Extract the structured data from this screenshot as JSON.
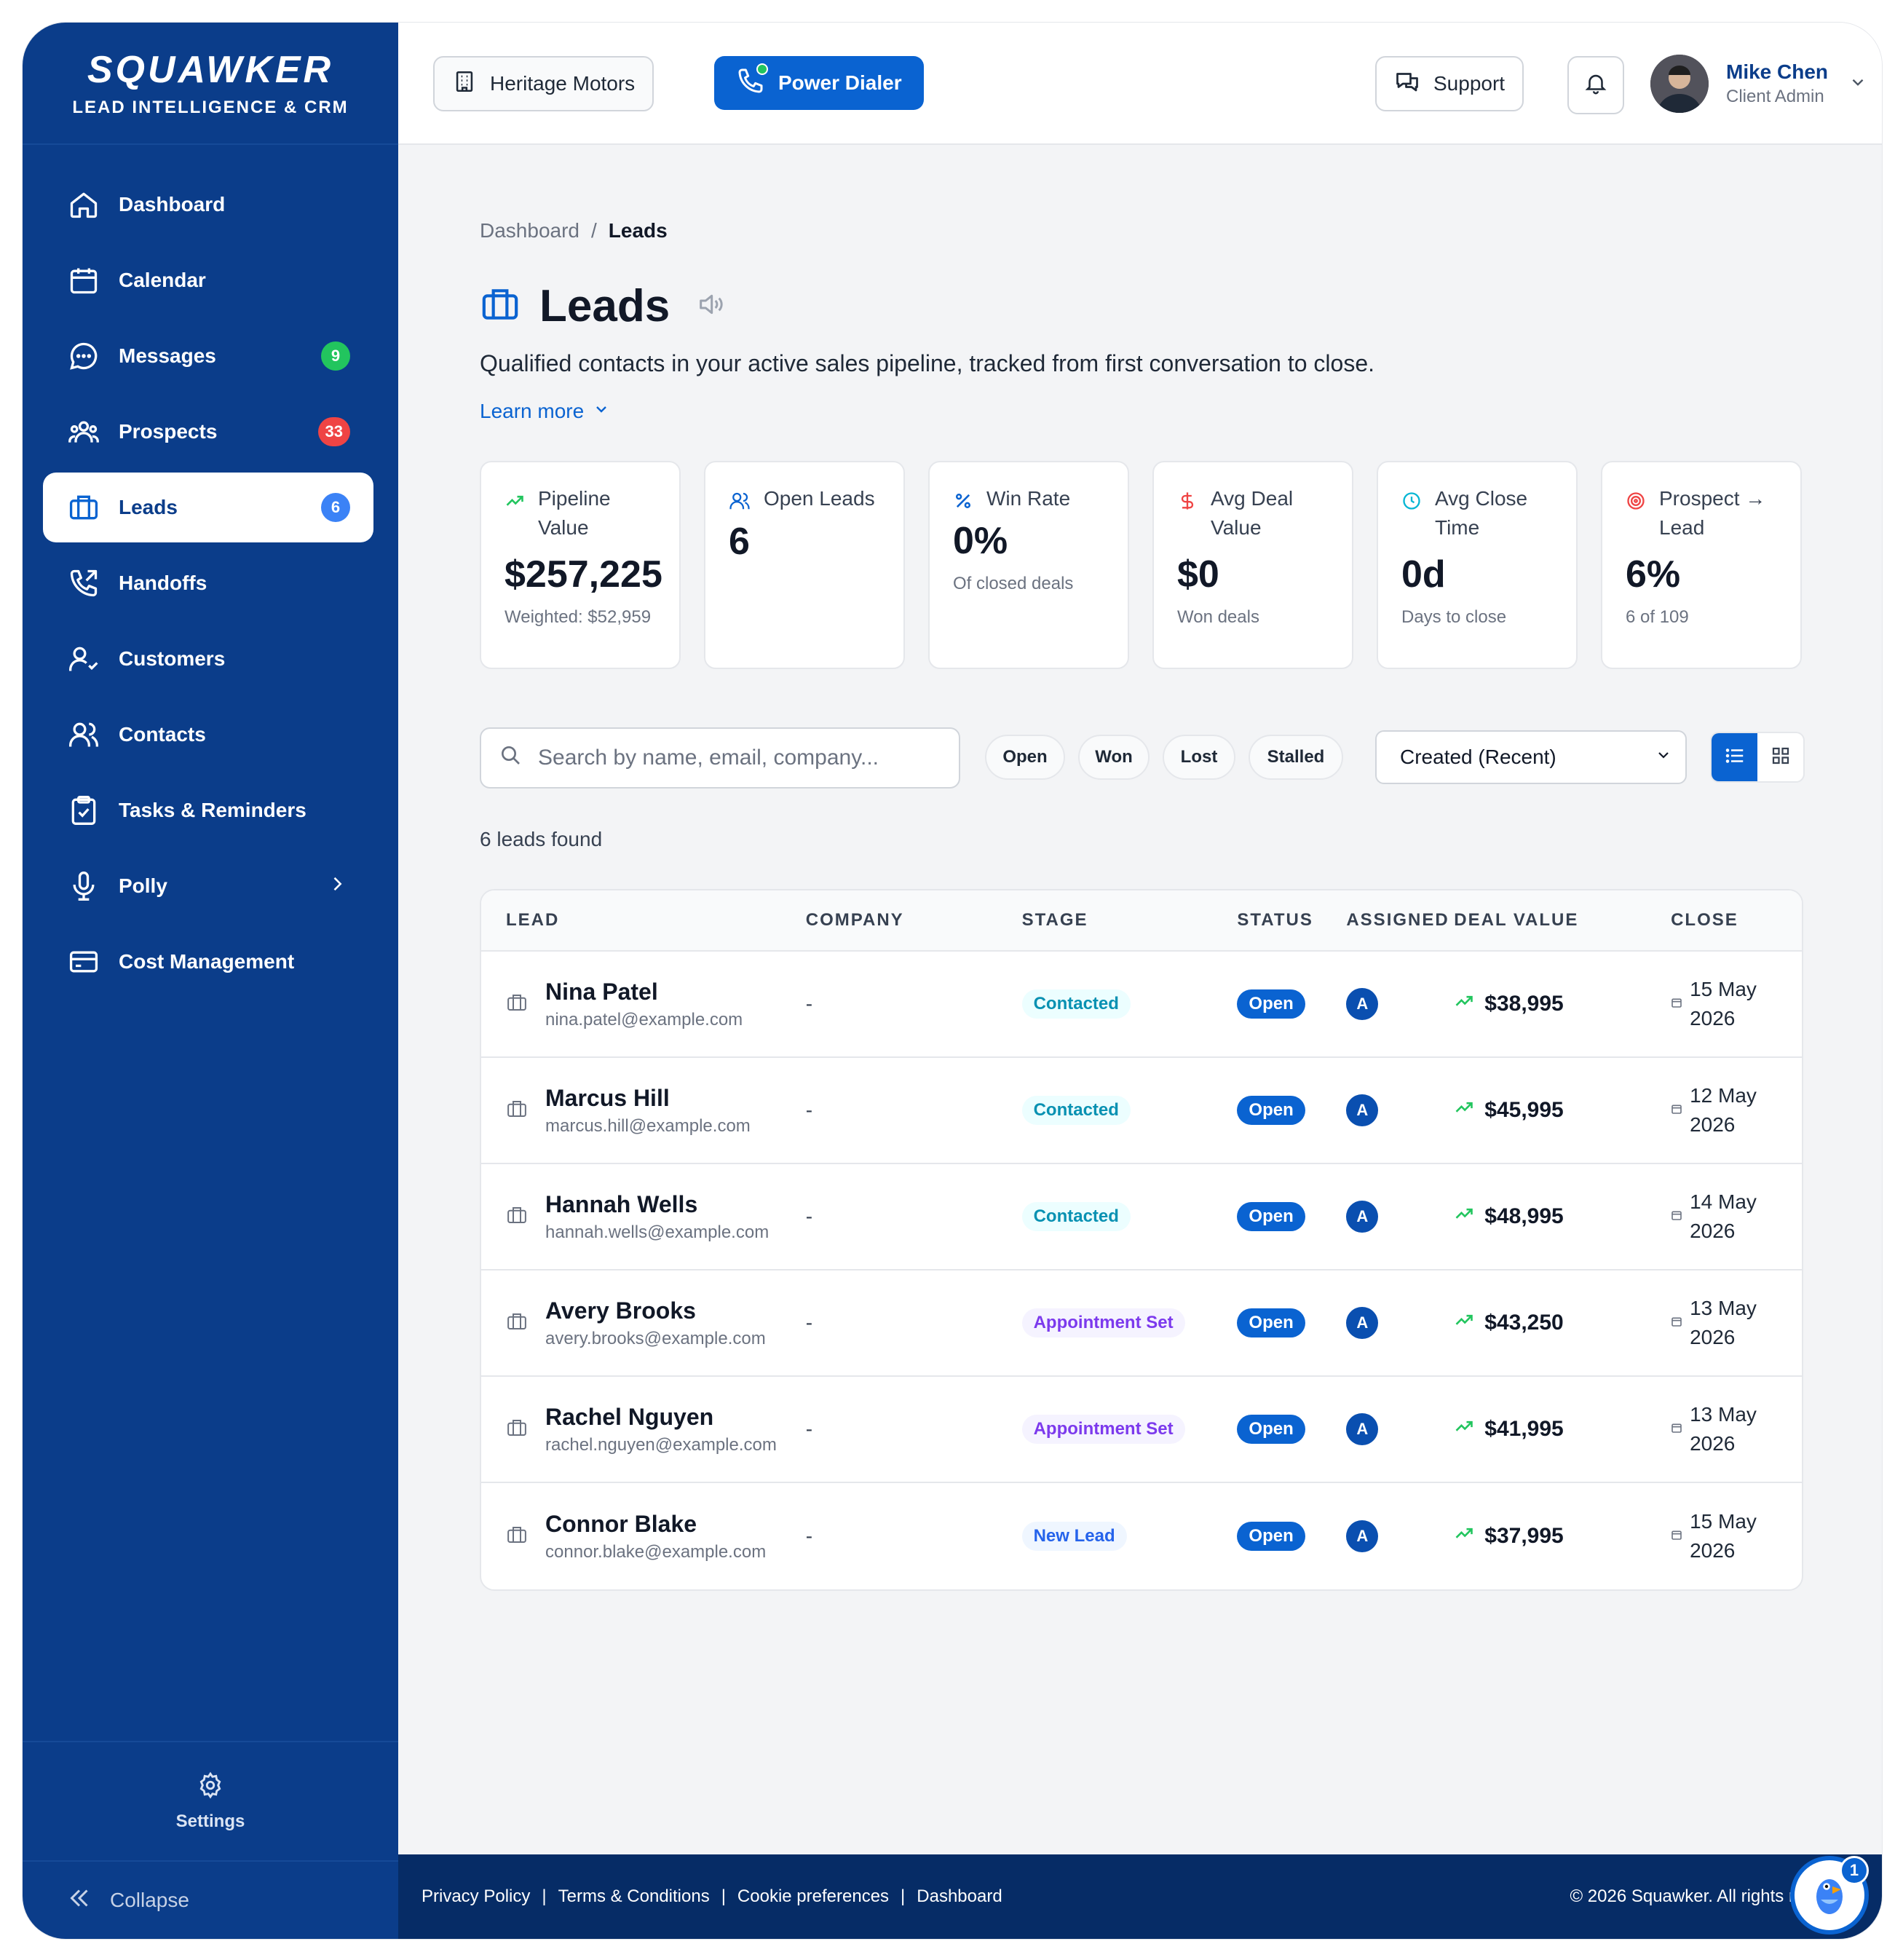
{
  "brand": {
    "name": "SQUAWKER",
    "tagline": "LEAD INTELLIGENCE & CRM"
  },
  "sidebar": {
    "items": [
      {
        "label": "Dashboard",
        "icon": "home-icon"
      },
      {
        "label": "Calendar",
        "icon": "calendar-icon"
      },
      {
        "label": "Messages",
        "icon": "chat-icon",
        "badge": "9",
        "badge_color": "#22c55e"
      },
      {
        "label": "Prospects",
        "icon": "people-icon",
        "badge": "33",
        "badge_color": "#ef4444"
      },
      {
        "label": "Leads",
        "icon": "briefcase-icon",
        "badge": "6",
        "badge_color": "#3b82f6",
        "active": true
      },
      {
        "label": "Handoffs",
        "icon": "phone-forward-icon"
      },
      {
        "label": "Customers",
        "icon": "user-check-icon"
      },
      {
        "label": "Contacts",
        "icon": "users-icon"
      },
      {
        "label": "Tasks & Reminders",
        "icon": "clipboard-check-icon"
      },
      {
        "label": "Polly",
        "icon": "microphone-icon",
        "has_submenu": true
      },
      {
        "label": "Cost Management",
        "icon": "credit-card-icon"
      }
    ],
    "settings_label": "Settings",
    "collapse_label": "Collapse"
  },
  "header": {
    "dealership": "Heritage Motors",
    "power_dialer": "Power Dialer",
    "support": "Support",
    "user": {
      "name": "Mike Chen",
      "role": "Client Admin"
    }
  },
  "breadcrumb": {
    "root": "Dashboard",
    "separator": "/",
    "current": "Leads"
  },
  "page": {
    "title": "Leads",
    "subtitle": "Qualified contacts in your active sales pipeline, tracked from first conversation to close.",
    "learn_more": "Learn more"
  },
  "stats": [
    {
      "label": "Pipeline Value",
      "value": "$257,225",
      "sub": "Weighted: $52,959",
      "icon": "trend-up-icon",
      "icon_color": "#22c55e"
    },
    {
      "label": "Open Leads",
      "value": "6",
      "sub": "",
      "icon": "users-icon",
      "icon_color": "#0a63d1"
    },
    {
      "label": "Win Rate",
      "value": "0%",
      "sub": "Of closed deals",
      "icon": "percent-icon",
      "icon_color": "#0a63d1"
    },
    {
      "label": "Avg Deal Value",
      "value": "$0",
      "sub": "Won deals",
      "icon": "dollar-icon",
      "icon_color": "#ef4444"
    },
    {
      "label": "Avg Close Time",
      "value": "0d",
      "sub": "Days to close",
      "icon": "clock-icon",
      "icon_color": "#06b6d4"
    },
    {
      "label": "Prospect → Lead",
      "value": "6%",
      "sub": "6 of 109",
      "icon": "target-icon",
      "icon_color": "#ef4444"
    }
  ],
  "search": {
    "placeholder": "Search by name, email, company..."
  },
  "filters": [
    "Open",
    "Won",
    "Lost",
    "Stalled"
  ],
  "sort": {
    "selected": "Created (Recent)"
  },
  "count_text": "6 leads found",
  "table": {
    "columns": [
      "LEAD",
      "COMPANY",
      "STAGE",
      "STATUS",
      "ASSIGNED",
      "DEAL VALUE",
      "CLOSE"
    ],
    "rows": [
      {
        "name": "Nina Patel",
        "email": "nina.patel@example.com",
        "company": "-",
        "stage": "Contacted",
        "status": "Open",
        "assigned": "A",
        "deal": "$38,995",
        "close_day": "15 May",
        "close_year": "2026"
      },
      {
        "name": "Marcus Hill",
        "email": "marcus.hill@example.com",
        "company": "-",
        "stage": "Contacted",
        "status": "Open",
        "assigned": "A",
        "deal": "$45,995",
        "close_day": "12 May",
        "close_year": "2026"
      },
      {
        "name": "Hannah Wells",
        "email": "hannah.wells@example.com",
        "company": "-",
        "stage": "Contacted",
        "status": "Open",
        "assigned": "A",
        "deal": "$48,995",
        "close_day": "14 May",
        "close_year": "2026"
      },
      {
        "name": "Avery Brooks",
        "email": "avery.brooks@example.com",
        "company": "-",
        "stage": "Appointment Set",
        "status": "Open",
        "assigned": "A",
        "deal": "$43,250",
        "close_day": "13 May",
        "close_year": "2026"
      },
      {
        "name": "Rachel Nguyen",
        "email": "rachel.nguyen@example.com",
        "company": "-",
        "stage": "Appointment Set",
        "status": "Open",
        "assigned": "A",
        "deal": "$41,995",
        "close_day": "13 May",
        "close_year": "2026"
      },
      {
        "name": "Connor Blake",
        "email": "connor.blake@example.com",
        "company": "-",
        "stage": "New Lead",
        "status": "Open",
        "assigned": "A",
        "deal": "$37,995",
        "close_day": "15 May",
        "close_year": "2026"
      }
    ]
  },
  "stage_colors": {
    "Contacted": {
      "bg": "#ecfeff",
      "fg": "#0891b2"
    },
    "Appointment Set": {
      "bg": "#f5f3ff",
      "fg": "#7c3aed"
    },
    "New Lead": {
      "bg": "#eff6ff",
      "fg": "#2563eb"
    }
  },
  "footer": {
    "links": [
      "Privacy Policy",
      "Terms & Conditions",
      "Cookie preferences",
      "Dashboard"
    ],
    "separator": "|",
    "copyright": "© 2026 Squawker. All rights reserved."
  },
  "chat_widget": {
    "badge": "1"
  },
  "colors": {
    "sidebar": "#0b3d8a",
    "primary": "#0a63d1",
    "footer": "#062c66"
  }
}
